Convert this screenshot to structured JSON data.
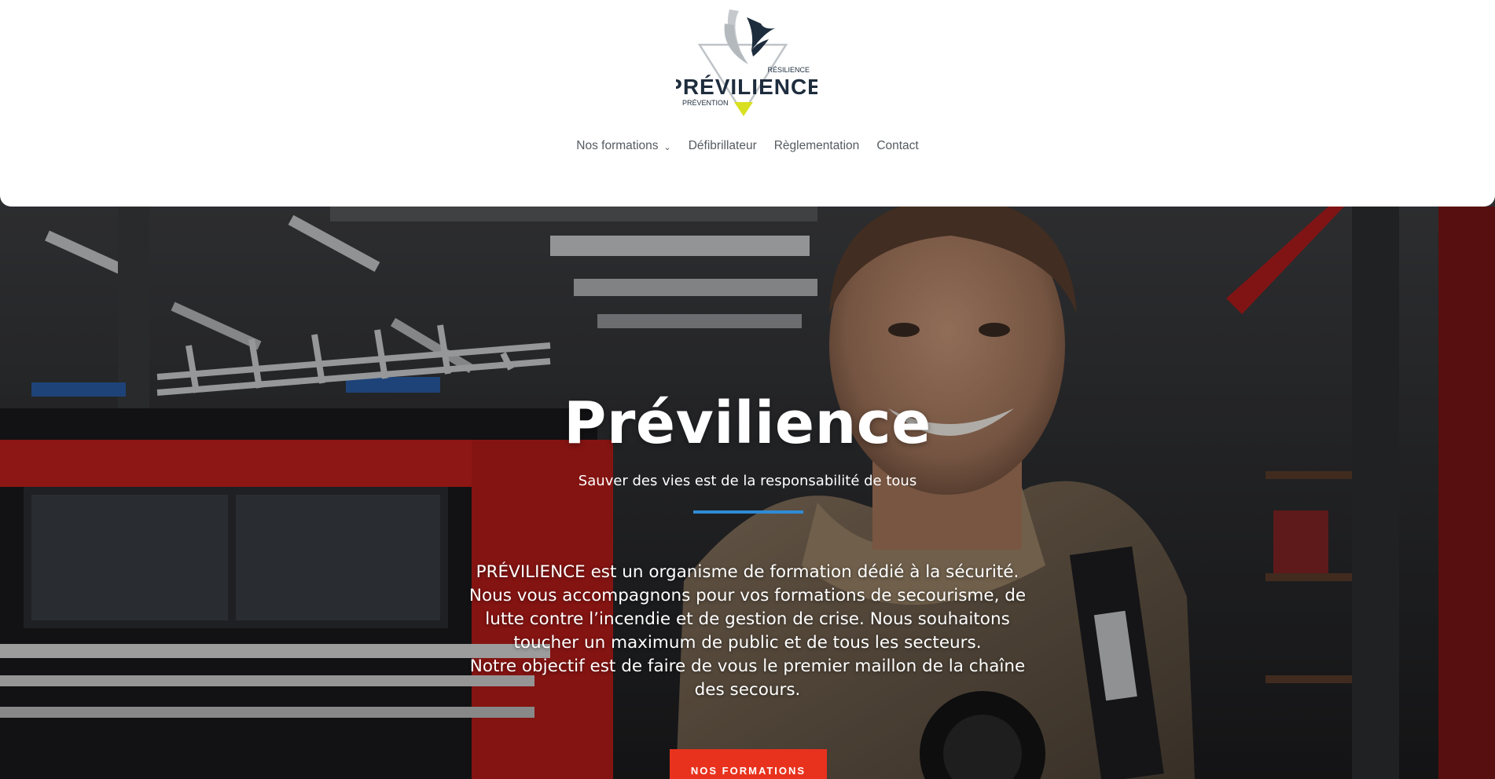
{
  "header": {
    "logo": {
      "brand": "PRÉVILIENCE",
      "tag_top": "RÉSILIENCE",
      "tag_bottom": "PRÉVENTION"
    },
    "nav": [
      {
        "label": "Nos formations",
        "has_dropdown": true
      },
      {
        "label": "Défibrillateur"
      },
      {
        "label": "Règlementation"
      },
      {
        "label": "Contact"
      }
    ]
  },
  "hero": {
    "title": "Prévilience",
    "subtitle": "Sauver des vies est de la responsabilité de tous",
    "body": [
      "PRÉVILIENCE est un organisme de formation dédié à la sécurité.",
      "Nous vous accompagnons pour vos formations de secourisme, de lutte contre l’incendie et de gestion de crise.  Nous souhaitons toucher un maximum de public et de tous les secteurs.",
      "Notre objectif est de faire de vous le premier maillon de la chaîne des secours."
    ],
    "cta_label": "NOS FORMATIONS"
  },
  "colors": {
    "accent_blue": "#2f8bd6",
    "cta_red": "#e8321e",
    "logo_navy": "#1e2d3d",
    "logo_yellow": "#d9e021",
    "nav_text": "#555b61"
  },
  "icons": {
    "dropdown": "chevron-down-icon",
    "logo_mark": "phoenix-bird-icon"
  }
}
